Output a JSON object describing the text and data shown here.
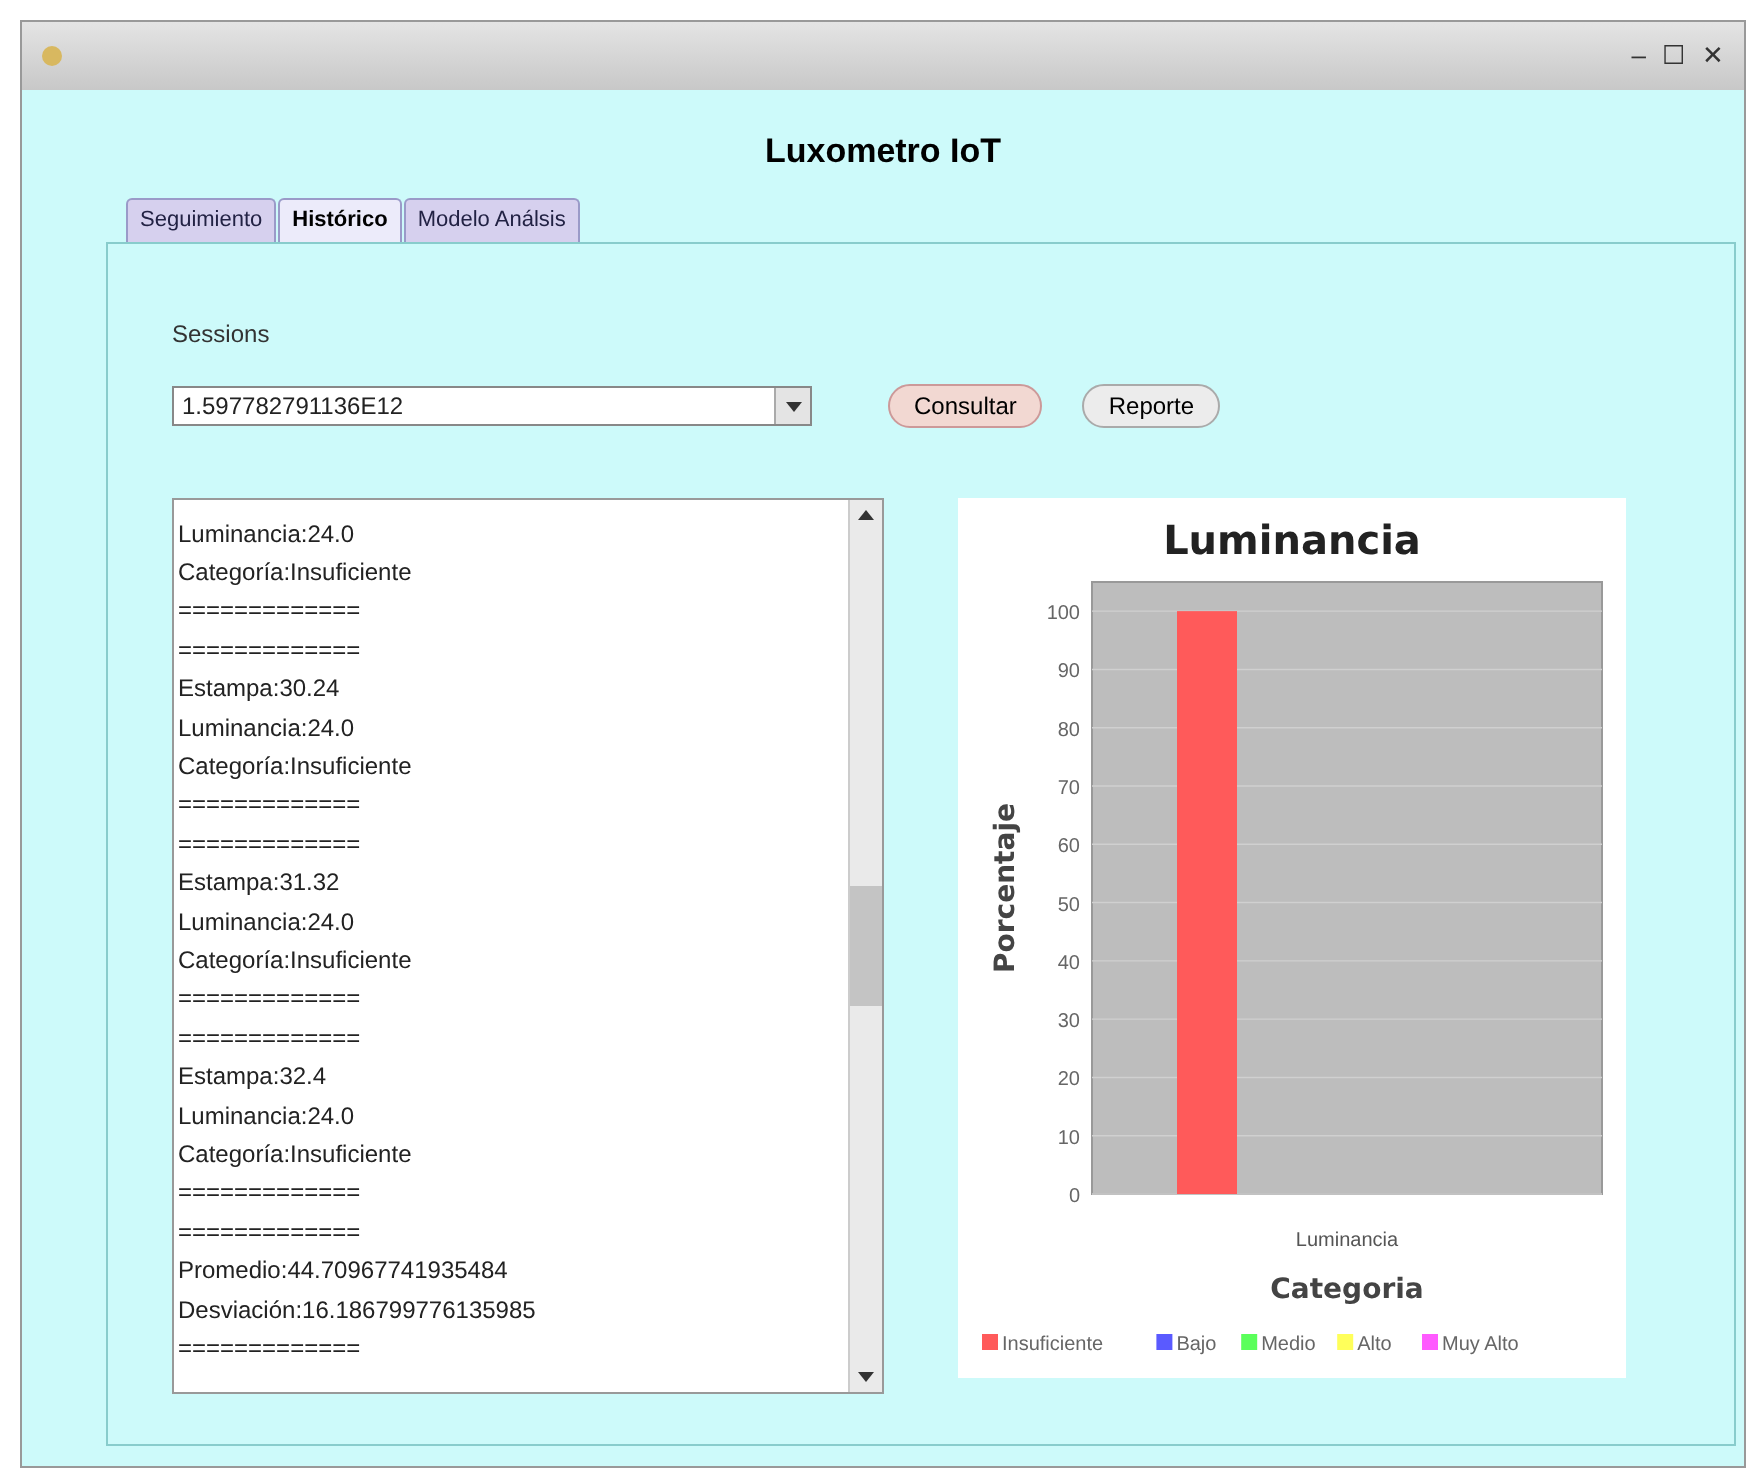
{
  "window": {
    "controls": [
      "–",
      "☐",
      "✕"
    ]
  },
  "title": "Luxometro IoT",
  "tabs": [
    {
      "label": "Seguimiento",
      "selected": false
    },
    {
      "label": "Histórico",
      "selected": true
    },
    {
      "label": "Modelo Análsis",
      "selected": false
    }
  ],
  "sessions": {
    "label": "Sessions",
    "value": "1.597782791136E12"
  },
  "buttons": [
    {
      "label": "Consultar",
      "focused": true
    },
    {
      "label": "Reporte",
      "focused": false
    }
  ],
  "log_lines": [
    "Luminancia:24.0",
    "Categoría:Insuficiente",
    "=============",
    "=============",
    "Estampa:30.24",
    "Luminancia:24.0",
    "Categoría:Insuficiente",
    "=============",
    "=============",
    "Estampa:31.32",
    "Luminancia:24.0",
    "Categoría:Insuficiente",
    "=============",
    "=============",
    "Estampa:32.4",
    "Luminancia:24.0",
    "Categoría:Insuficiente",
    "=============",
    "=============",
    "Promedio:44.70967741935484",
    "Desviación:16.186799776135985",
    "============="
  ],
  "chart_data": {
    "type": "bar",
    "grid": true,
    "title": "Luminancia",
    "xlabel": "Categoria",
    "ylabel": "Porcentaje",
    "categories": [
      "Luminancia"
    ],
    "ylim": [
      0,
      105
    ],
    "yticks": [
      0,
      10,
      20,
      30,
      40,
      50,
      60,
      70,
      80,
      90,
      100
    ],
    "series": [
      {
        "name": "Insuficiente",
        "color": "#ff5a5a",
        "values": [
          100
        ]
      },
      {
        "name": "Bajo",
        "color": "#5a5aff",
        "values": [
          0
        ]
      },
      {
        "name": "Medio",
        "color": "#5aff5a",
        "values": [
          0
        ]
      },
      {
        "name": "Alto",
        "color": "#ffff5a",
        "values": [
          0
        ]
      },
      {
        "name": "Muy Alto",
        "color": "#ff5aff",
        "values": [
          0
        ]
      }
    ]
  }
}
